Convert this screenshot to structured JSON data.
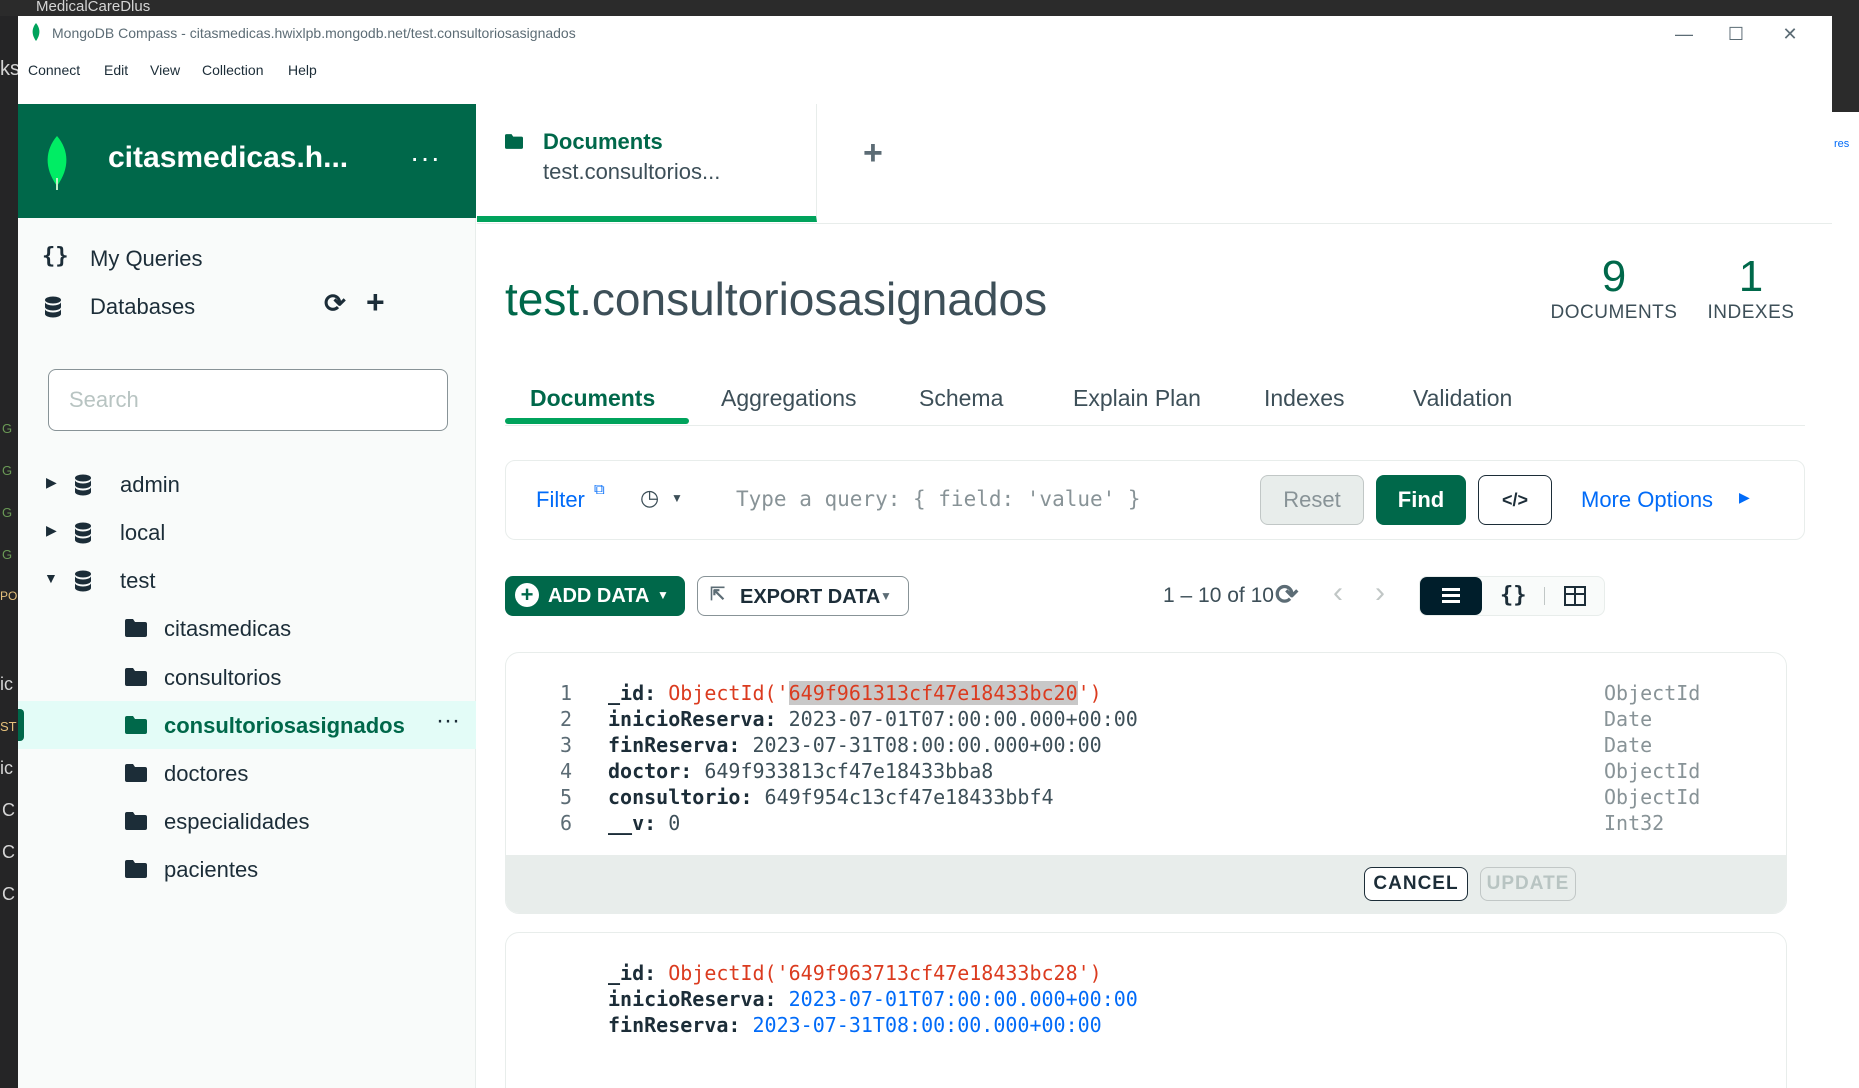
{
  "desktop": {
    "top_title": "MedicalCareDlus",
    "left_fragments": [
      "ks",
      "G",
      "G",
      "G",
      "G",
      "PO",
      "ic",
      "ST",
      "ic",
      "C",
      "C",
      "C"
    ],
    "right_fragment": "res"
  },
  "window": {
    "title": "MongoDB Compass - citasmedicas.hwixlpb.mongodb.net/test.consultoriosasignados",
    "menu": [
      "Connect",
      "Edit",
      "View",
      "Collection",
      "Help"
    ],
    "controls": {
      "minimize": "—",
      "maximize": "☐",
      "close": "✕"
    }
  },
  "sidebar": {
    "connection_name": "citasmedicas.h...",
    "my_queries": "My Queries",
    "databases": "Databases",
    "search_placeholder": "Search",
    "dbs": [
      {
        "name": "admin",
        "expanded": false
      },
      {
        "name": "local",
        "expanded": false
      },
      {
        "name": "test",
        "expanded": true
      }
    ],
    "collections": [
      "citasmedicas",
      "consultorios",
      "consultoriosasignados",
      "doctores",
      "especialidades",
      "pacientes"
    ],
    "selected_collection": "consultoriosasignados"
  },
  "tab": {
    "title": "Documents",
    "subtitle": "test.consultorios..."
  },
  "collection": {
    "db": "test",
    "name": ".consultoriosasignados",
    "documents_count": "9",
    "documents_label": "DOCUMENTS",
    "indexes_count": "1",
    "indexes_label": "INDEXES"
  },
  "subtabs": [
    "Documents",
    "Aggregations",
    "Schema",
    "Explain Plan",
    "Indexes",
    "Validation"
  ],
  "query": {
    "filter_label": "Filter",
    "placeholder": "Type a query: { field: 'value' }",
    "reset": "Reset",
    "find": "Find",
    "code_icon": "</>",
    "more_options": "More Options"
  },
  "toolbar": {
    "add_data": "ADD DATA",
    "export_data": "EXPORT DATA",
    "pagination": "1 – 10 of 10"
  },
  "documents": [
    {
      "editing": true,
      "fields": [
        {
          "line": "1",
          "key": "_id",
          "value_prefix": "ObjectId('",
          "value_highlight": "649f961313cf47e18433bc20",
          "value_suffix": "')",
          "type": "ObjectId",
          "style": "oid"
        },
        {
          "line": "2",
          "key": "inicioReserva",
          "value": "2023-07-01T07:00:00.000+00:00",
          "type": "Date",
          "style": "dark"
        },
        {
          "line": "3",
          "key": "finReserva",
          "value": "2023-07-31T08:00:00.000+00:00",
          "type": "Date",
          "style": "dark"
        },
        {
          "line": "4",
          "key": "doctor",
          "value": "649f933813cf47e18433bba8",
          "type": "ObjectId",
          "style": "dark"
        },
        {
          "line": "5",
          "key": "consultorio",
          "value": "649f954c13cf47e18433bbf4",
          "type": "ObjectId",
          "style": "dark"
        },
        {
          "line": "6",
          "key": "__v",
          "value": "0",
          "type": "Int32",
          "style": "dark"
        }
      ],
      "cancel": "CANCEL",
      "update": "UPDATE"
    },
    {
      "editing": false,
      "fields": [
        {
          "key": "_id",
          "value": "ObjectId('649f963713cf47e18433bc28')",
          "style": "oid"
        },
        {
          "key": "inicioReserva",
          "value": "2023-07-01T07:00:00.000+00:00",
          "style": "blue"
        },
        {
          "key": "finReserva",
          "value": "2023-07-31T08:00:00.000+00:00",
          "style": "blue"
        }
      ]
    }
  ],
  "colors": {
    "brand_green": "#00684a",
    "accent_green": "#00a35c",
    "link_blue": "#016bf8",
    "oid_red": "#db3b1f"
  }
}
